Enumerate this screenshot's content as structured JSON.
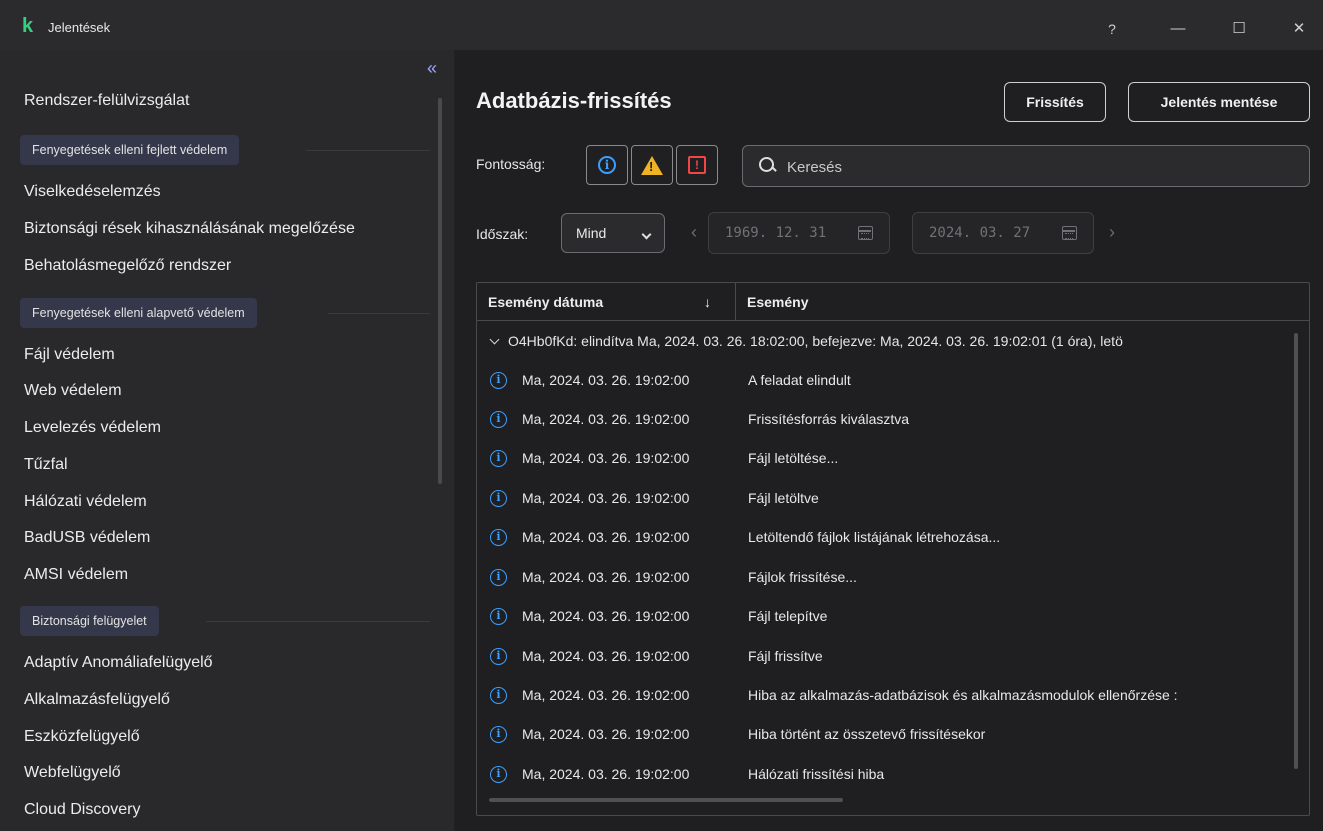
{
  "window": {
    "title": "Jelentések",
    "logo_glyph": "k",
    "help_glyph": "?",
    "minimize_glyph": "—",
    "maximize_glyph": "☐",
    "close_glyph": "✕"
  },
  "sidebar": {
    "collapse_glyph": "«",
    "items_top": [
      "Rendszer-felülvizsgálat"
    ],
    "groups": [
      {
        "label": "Fenyegetések elleni fejlett védelem",
        "items": [
          "Viselkedéselemzés",
          "Biztonsági rések kihasználásának megelőzése",
          "Behatolásmegelőző rendszer"
        ]
      },
      {
        "label": "Fenyegetések elleni alapvető védelem",
        "items": [
          "Fájl védelem",
          "Web védelem",
          "Levelezés védelem",
          "Tűzfal",
          "Hálózati védelem",
          "BadUSB védelem",
          "AMSI védelem"
        ]
      },
      {
        "label": "Biztonsági felügyelet",
        "items": [
          "Adaptív Anomáliafelügyelő",
          "Alkalmazásfelügyelő",
          "Eszközfelügyelő",
          "Webfelügyelő",
          "Cloud Discovery"
        ]
      }
    ]
  },
  "main": {
    "title": "Adatbázis-frissítés",
    "refresh_label": "Frissítés",
    "save_report_label": "Jelentés mentése",
    "severity_label": "Fontosság:",
    "search_placeholder": "Keresés",
    "period_label": "Időszak:",
    "period_value": "Mind",
    "date_from": "1969. 12. 31",
    "date_to": "2024. 03. 27",
    "prev_glyph": "‹",
    "next_glyph": "›"
  },
  "table": {
    "columns": [
      "Esemény dátuma",
      "Esemény"
    ],
    "sort_glyph": "↓",
    "group_row": "O4Hb0fKd: elindítva Ma, 2024. 03. 26. 18:02:00, befejezve: Ma, 2024. 03. 26. 19:02:01 (1 óra), letö",
    "rows": [
      {
        "date": "Ma, 2024. 03. 26. 19:02:00",
        "event": "A feladat elindult"
      },
      {
        "date": "Ma, 2024. 03. 26. 19:02:00",
        "event": "Frissítésforrás kiválasztva"
      },
      {
        "date": "Ma, 2024. 03. 26. 19:02:00",
        "event": "Fájl letöltése..."
      },
      {
        "date": "Ma, 2024. 03. 26. 19:02:00",
        "event": "Fájl letöltve"
      },
      {
        "date": "Ma, 2024. 03. 26. 19:02:00",
        "event": "Letöltendő fájlok listájának létrehozása..."
      },
      {
        "date": "Ma, 2024. 03. 26. 19:02:00",
        "event": "Fájlok frissítése..."
      },
      {
        "date": "Ma, 2024. 03. 26. 19:02:00",
        "event": "Fájl telepítve"
      },
      {
        "date": "Ma, 2024. 03. 26. 19:02:00",
        "event": "Fájl frissítve"
      },
      {
        "date": "Ma, 2024. 03. 26. 19:02:00",
        "event": "Hiba az alkalmazás-adatbázisok és alkalmazásmodulok ellenőrzése :"
      },
      {
        "date": "Ma, 2024. 03. 26. 19:02:00",
        "event": "Hiba történt az összetevő frissítésekor"
      },
      {
        "date": "Ma, 2024. 03. 26. 19:02:00",
        "event": "Hálózati frissítési hiba"
      }
    ]
  },
  "colors": {
    "accent_green": "#35d07f",
    "info_blue": "#3aa0ff",
    "warning_yellow": "#f0b323",
    "error_red": "#f04646"
  }
}
